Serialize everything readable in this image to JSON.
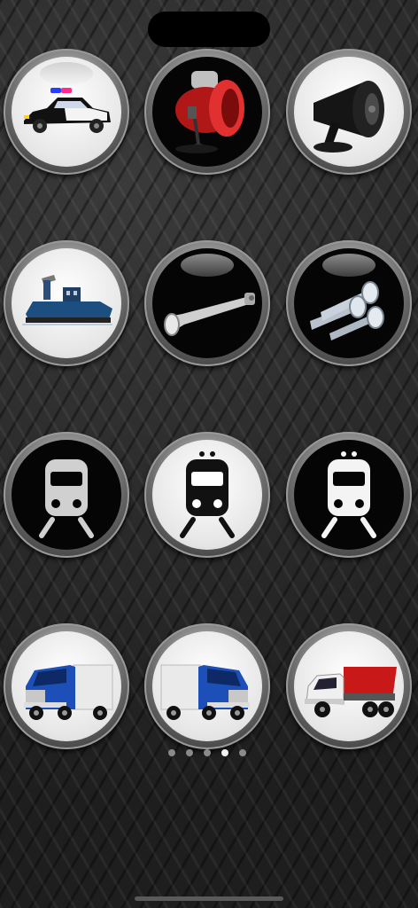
{
  "pager": {
    "page_count": 5,
    "current_page": 4
  },
  "colors": {
    "background": "#2e2e2e",
    "dot_active": "#f4f4f4",
    "dot_inactive": "#8a8a8a"
  },
  "buttons": [
    {
      "name": "police-car-siren-button",
      "icon": "police-car-icon",
      "face": "white"
    },
    {
      "name": "red-horn-siren-button",
      "icon": "red-siren-icon",
      "face": "black"
    },
    {
      "name": "megaphone-speaker-button",
      "icon": "megaphone-icon",
      "face": "white"
    },
    {
      "name": "tugboat-horn-button",
      "icon": "tugboat-icon",
      "face": "white"
    },
    {
      "name": "single-air-horn-button",
      "icon": "air-horn-icon",
      "face": "black"
    },
    {
      "name": "triple-air-horn-button",
      "icon": "triple-air-horn-icon",
      "face": "black"
    },
    {
      "name": "train-horn-1-button",
      "icon": "train-icon",
      "face": "black"
    },
    {
      "name": "train-horn-2-button",
      "icon": "train-icon",
      "face": "white"
    },
    {
      "name": "train-horn-3-button",
      "icon": "train-icon",
      "face": "black"
    },
    {
      "name": "semi-truck-horn-1-button",
      "icon": "semi-truck-icon",
      "face": "white"
    },
    {
      "name": "semi-truck-horn-2-button",
      "icon": "semi-truck-icon",
      "face": "white"
    },
    {
      "name": "dump-truck-horn-button",
      "icon": "dump-truck-icon",
      "face": "white"
    }
  ]
}
